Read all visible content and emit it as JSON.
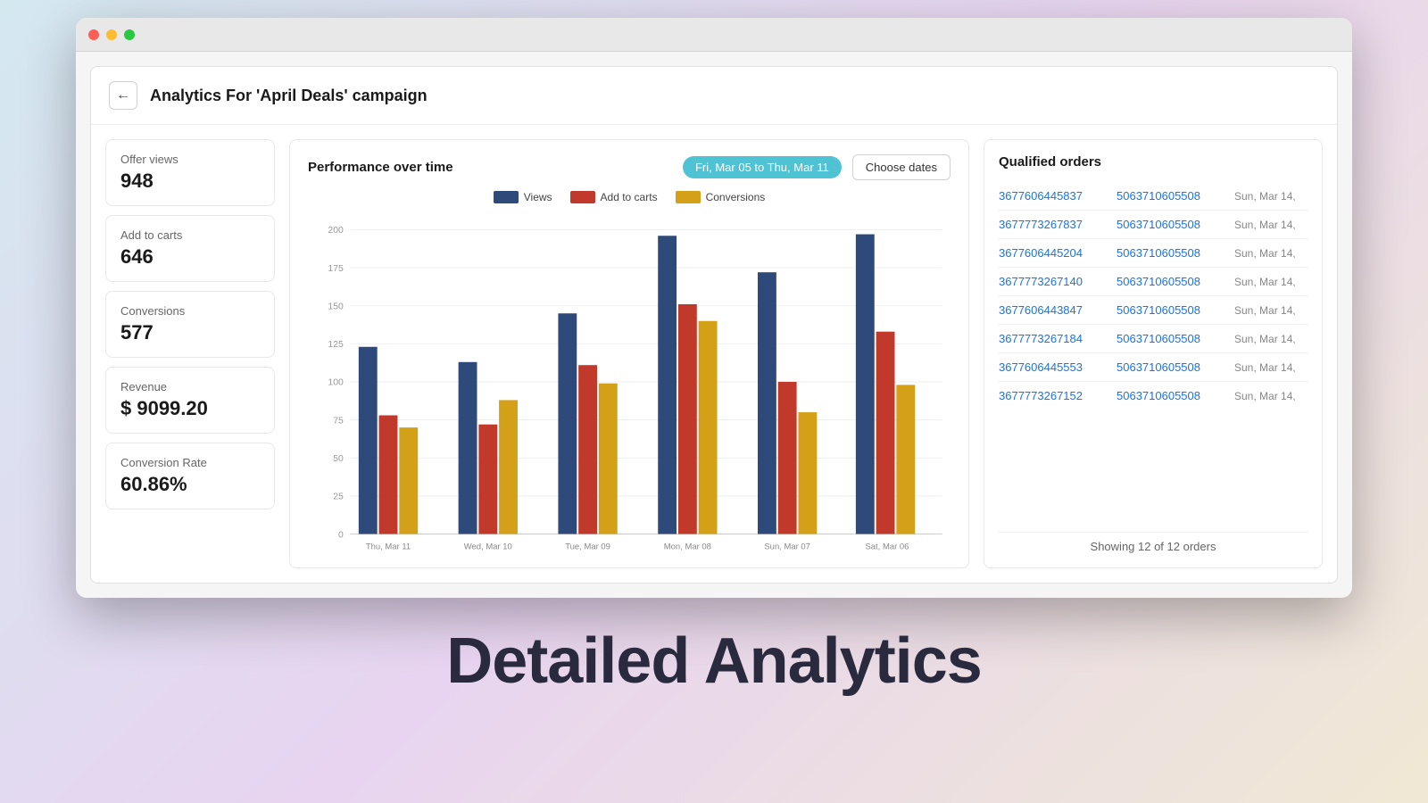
{
  "window": {
    "title": "Analytics For 'April Deals' campaign"
  },
  "header": {
    "back_label": "←",
    "title": "Analytics For 'April Deals' campaign"
  },
  "stats": [
    {
      "label": "Offer views",
      "value": "948"
    },
    {
      "label": "Add to carts",
      "value": "646"
    },
    {
      "label": "Conversions",
      "value": "577"
    },
    {
      "label": "Revenue",
      "value": "$ 9099.20"
    },
    {
      "label": "Conversion Rate",
      "value": "60.86%"
    }
  ],
  "chart": {
    "title": "Performance over time",
    "date_range": "Fri, Mar 05 to Thu, Mar 11",
    "choose_dates_label": "Choose dates",
    "legend": [
      {
        "label": "Views",
        "color": "#2d4a7a"
      },
      {
        "label": "Add to carts",
        "color": "#c0392b"
      },
      {
        "label": "Conversions",
        "color": "#d4a017"
      }
    ],
    "y_labels": [
      "200",
      "175",
      "150",
      "125",
      "100",
      "75",
      "50",
      "25",
      "0"
    ],
    "bars": [
      {
        "day": "Thu, Mar 11",
        "views": 123,
        "carts": 78,
        "conversions": 70
      },
      {
        "day": "Wed, Mar 10",
        "views": 113,
        "carts": 72,
        "conversions": 88
      },
      {
        "day": "Tue, Mar 09",
        "views": 145,
        "carts": 111,
        "conversions": 99
      },
      {
        "day": "Mon, Mar 08",
        "views": 196,
        "carts": 151,
        "conversions": 140
      },
      {
        "day": "Sun, Mar 07",
        "views": 172,
        "carts": 100,
        "conversions": 80
      },
      {
        "day": "Sat, Mar 06",
        "views": 197,
        "carts": 133,
        "conversions": 98
      }
    ]
  },
  "qualified_orders": {
    "title": "Qualified orders",
    "orders": [
      {
        "order_id": "3677606445837",
        "customer_id": "5063710605508",
        "date": "Sun, Mar 14,"
      },
      {
        "order_id": "3677773267837",
        "customer_id": "5063710605508",
        "date": "Sun, Mar 14,"
      },
      {
        "order_id": "3677606445204",
        "customer_id": "5063710605508",
        "date": "Sun, Mar 14,"
      },
      {
        "order_id": "3677773267140",
        "customer_id": "5063710605508",
        "date": "Sun, Mar 14,"
      },
      {
        "order_id": "3677606443847",
        "customer_id": "5063710605508",
        "date": "Sun, Mar 14,"
      },
      {
        "order_id": "3677773267184",
        "customer_id": "5063710605508",
        "date": "Sun, Mar 14,"
      },
      {
        "order_id": "3677606445553",
        "customer_id": "5063710605508",
        "date": "Sun, Mar 14,"
      },
      {
        "order_id": "3677773267152",
        "customer_id": "5063710605508",
        "date": "Sun, Mar 14,"
      }
    ],
    "showing_text": "Showing 12 of 12 orders"
  },
  "bottom_banner": {
    "text": "Detailed Analytics"
  }
}
